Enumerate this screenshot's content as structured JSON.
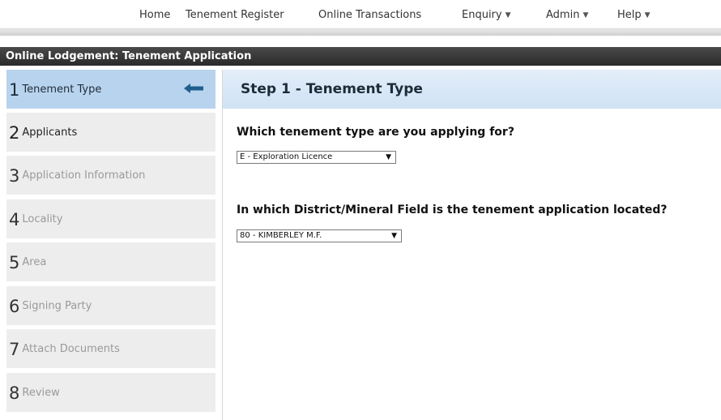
{
  "nav": {
    "items": [
      {
        "label": "Home"
      },
      {
        "label": "Tenement Register"
      },
      {
        "label": "Online Transactions"
      },
      {
        "label": "Enquiry",
        "dropdown": true
      },
      {
        "label": "Admin",
        "dropdown": true
      },
      {
        "label": "Help",
        "dropdown": true
      }
    ]
  },
  "page": {
    "title": "Online Lodgement: Tenement Application"
  },
  "steps": [
    {
      "number": "1",
      "label": "Tenement Type",
      "state": "active"
    },
    {
      "number": "2",
      "label": "Applicants",
      "state": "enabled"
    },
    {
      "number": "3",
      "label": "Application Information",
      "state": "disabled"
    },
    {
      "number": "4",
      "label": "Locality",
      "state": "disabled"
    },
    {
      "number": "5",
      "label": "Area",
      "state": "disabled"
    },
    {
      "number": "6",
      "label": "Signing Party",
      "state": "disabled"
    },
    {
      "number": "7",
      "label": "Attach Documents",
      "state": "disabled"
    },
    {
      "number": "8",
      "label": "Review",
      "state": "disabled"
    }
  ],
  "main": {
    "step_title": "Step 1 - Tenement Type",
    "q1": {
      "label": "Which tenement type are you applying for?",
      "selected": "E - Exploration Licence"
    },
    "q2": {
      "label": "In which District/Mineral Field is the tenement application located?",
      "selected": "80 - KIMBERLEY M.F."
    }
  },
  "icons": {
    "caret": "triangle-down-icon",
    "active_step": "arrow-left-icon"
  },
  "colors": {
    "active_step_bg": "#b8d3ee",
    "step_bg": "#ededed",
    "header_bar": "#2f2f2f",
    "arrow": "#1f5f8b"
  }
}
